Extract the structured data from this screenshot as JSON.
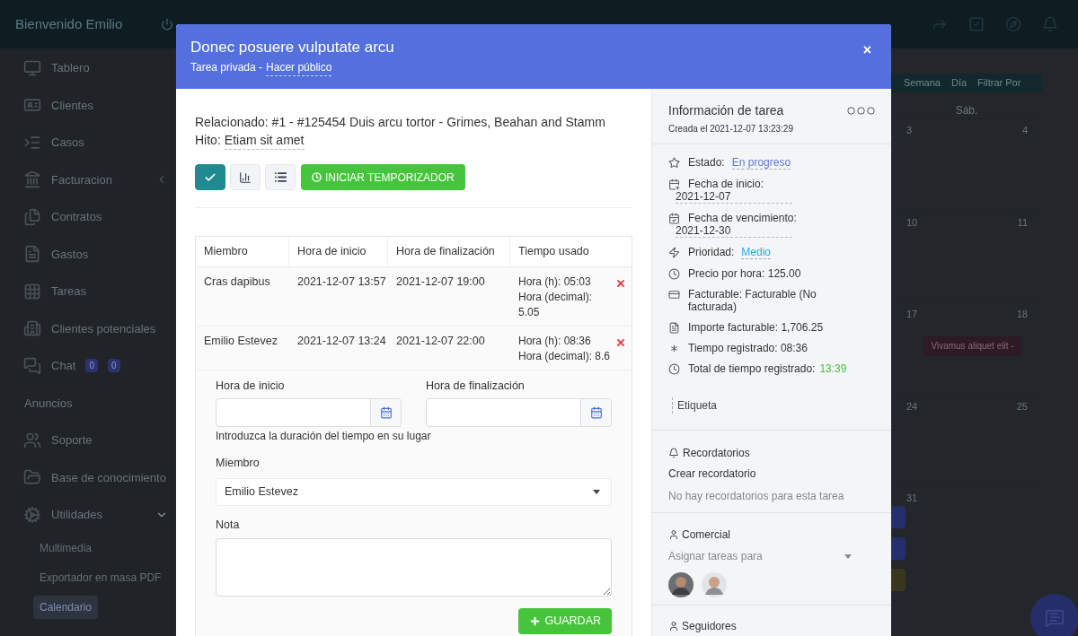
{
  "topbar": {
    "welcome": "Bienvenido Emilio"
  },
  "sidebar": {
    "items": [
      {
        "kind": "dashboard",
        "label": "Tablero"
      },
      {
        "kind": "clients",
        "label": "Clientes"
      },
      {
        "kind": "cases",
        "label": "Casos"
      },
      {
        "kind": "billing",
        "label": "Facturacion",
        "expanded": false
      },
      {
        "kind": "contracts",
        "label": "Contratos"
      },
      {
        "kind": "expenses",
        "label": "Gastos"
      },
      {
        "kind": "tasks",
        "label": "Tareas"
      },
      {
        "kind": "leads",
        "label": "Clientes potenciales"
      },
      {
        "kind": "chat",
        "label": "Chat",
        "badges": [
          "0",
          "0"
        ]
      },
      {
        "kind": "heading",
        "label": "Anuncios"
      },
      {
        "kind": "support",
        "label": "Soporte"
      },
      {
        "kind": "knowledge",
        "label": "Base de conocimiento"
      },
      {
        "kind": "utilities",
        "label": "Utilidades",
        "expanded": true,
        "children": [
          {
            "label": "Multimedia",
            "selected": false
          },
          {
            "label": "Exportador en masa PDF",
            "selected": false
          },
          {
            "label": "Calendario",
            "selected": true
          }
        ]
      }
    ]
  },
  "calendar": {
    "view_buttons": [
      "Semana",
      "Día",
      "Filtrar Por"
    ],
    "weekday": "Sáb.",
    "weeks": [
      [
        "3",
        "4"
      ],
      [
        "10",
        "11"
      ],
      [
        "17",
        "18"
      ],
      [
        "24",
        "25"
      ],
      [
        "31"
      ]
    ],
    "event": "Vivamus aliquet elit -",
    "chips": [
      {
        "color": "#252f6b"
      },
      {
        "color": "#252f6b"
      },
      {
        "color": "#3b3620"
      }
    ]
  },
  "modal": {
    "title": "Donec posuere vulputate arcu",
    "privacy": "Tarea privada -",
    "make_public": "Hacer público",
    "close": "×",
    "related": "Relacionado: #1 - #125454 Duis arcu tortor - Grimes, Beahan and Stamm",
    "milestone_label": "Hito:",
    "milestone": "Etiam sit amet",
    "actions": [
      {
        "kind": "complete",
        "selected": true
      },
      {
        "kind": "chart",
        "selected": false
      },
      {
        "kind": "list",
        "selected": false
      }
    ],
    "timer_button": "INICIAR TEMPORIZADOR",
    "table": {
      "columns": [
        "Miembro",
        "Hora de inicio",
        "Hora de finalización",
        "Tiempo usado"
      ],
      "rows": [
        {
          "member": "Cras dapibus",
          "start": "2021-12-07 13:57",
          "end": "2021-12-07 19:00",
          "hours": "Hora (h): 05:03",
          "decimal": "Hora (decimal): 5.05"
        },
        {
          "member": "Emilio Estevez",
          "start": "2021-12-07 13:24",
          "end": "2021-12-07 22:00",
          "hours": "Hora (h): 08:36",
          "decimal": "Hora (decimal): 8.6"
        }
      ]
    },
    "form": {
      "start_label": "Hora de inicio",
      "end_label": "Hora de finalización",
      "duration_hint": "Introduzca la duración del tiempo en su lugar",
      "member_label": "Miembro",
      "member_value": "Emilio Estevez",
      "note_label": "Nota",
      "save": "GUARDAR"
    }
  },
  "info": {
    "title": "Información de tarea",
    "created": "Creada el 2021-12-07 13:23:29",
    "fields": [
      {
        "kind": "status",
        "label": "Estado:",
        "value": "En progreso"
      },
      {
        "kind": "start_date",
        "label": "Fecha de inicio:",
        "value": "2021-12-07"
      },
      {
        "kind": "due_date",
        "label": "Fecha de vencimiento:",
        "value": "2021-12-30"
      },
      {
        "kind": "priority",
        "label": "Prioridad:",
        "value": "Medio"
      },
      {
        "kind": "rate",
        "label": "Precio por hora:",
        "value": "125.00"
      },
      {
        "kind": "billable",
        "label": "Facturable:",
        "value": "Facturable (No facturada)"
      },
      {
        "kind": "amount",
        "label": "Importe facturable:",
        "value": "1,706.25"
      },
      {
        "kind": "logged",
        "label": "Tiempo registrado:",
        "value": "08:36"
      },
      {
        "kind": "total",
        "label": "Total de tiempo registrado:",
        "value": "13:39"
      }
    ],
    "tags_placeholder": "Etiqueta",
    "reminders": {
      "title": "Recordatorios",
      "create": "Crear recordatorio",
      "empty": "No hay recordatorios para esta tarea"
    },
    "assignees": {
      "title": "Comercial",
      "placeholder": "Asignar tareas para",
      "people": [
        {
          "kind": "avatar"
        },
        {
          "kind": "avatar"
        }
      ]
    },
    "followers": {
      "title": "Seguidores"
    }
  }
}
